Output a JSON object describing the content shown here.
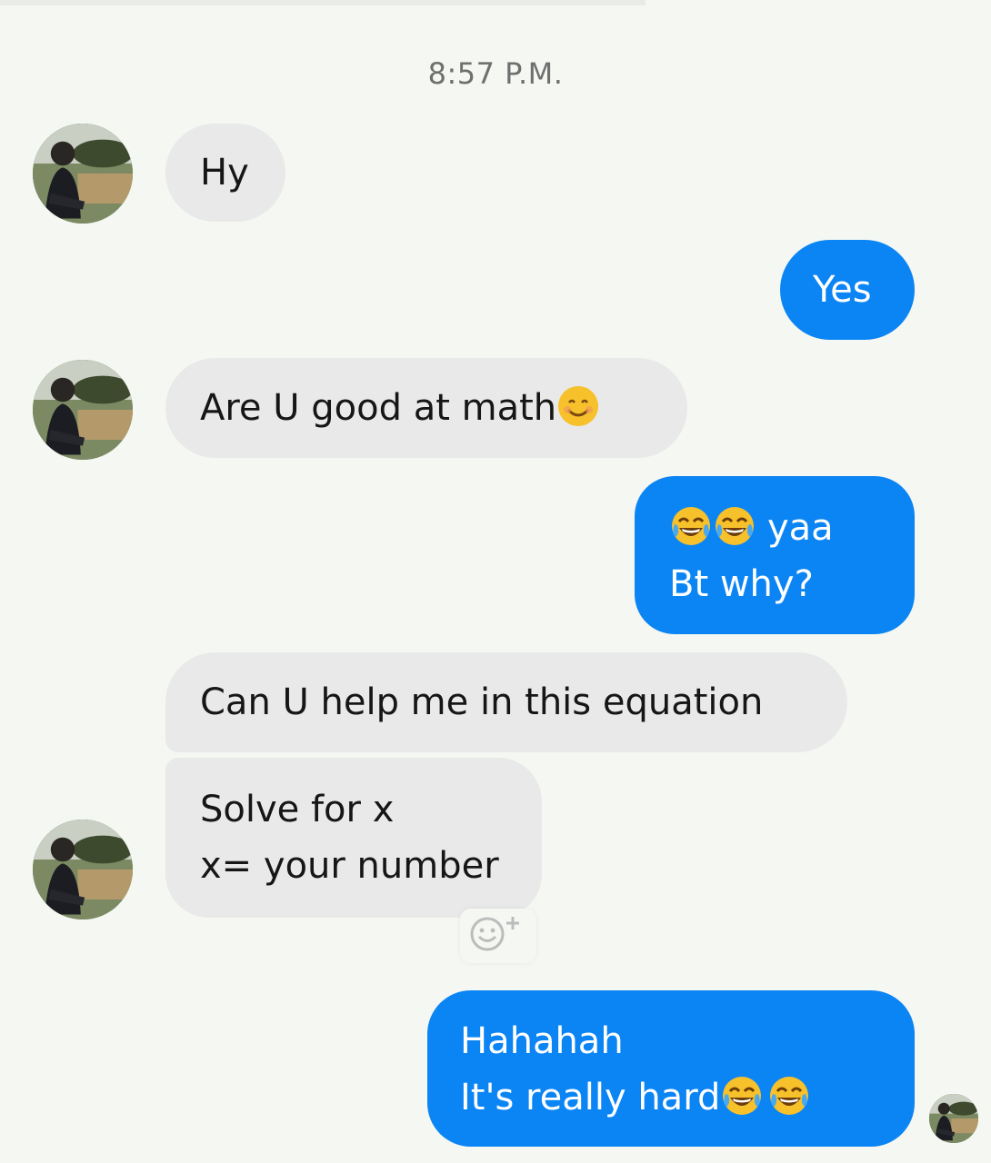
{
  "conversation": {
    "timestamp": "8:57 P.M.",
    "messages": [
      {
        "direction": "incoming",
        "lines": [
          "Hy"
        ]
      },
      {
        "direction": "outgoing",
        "lines": [
          "Yes"
        ]
      },
      {
        "direction": "incoming",
        "lines": [
          "Are U good at math"
        ],
        "emoji": [
          "smiling-face"
        ]
      },
      {
        "direction": "outgoing",
        "lines": [
          "yaa",
          "Bt why?"
        ],
        "emoji": [
          "face-with-tears-of-joy",
          "face-with-tears-of-joy"
        ]
      },
      {
        "direction": "incoming",
        "lines": [
          "Can U help me in this equation"
        ]
      },
      {
        "direction": "incoming",
        "lines": [
          "Solve for x",
          "x= your number"
        ]
      },
      {
        "direction": "outgoing",
        "lines": [
          "Hahahah",
          "It's really hard"
        ],
        "emoji": [
          "face-with-tears-of-joy",
          "face-with-tears-of-joy"
        ]
      }
    ]
  },
  "icons": {
    "add_reaction": "add-reaction-icon",
    "avatar": "contact-avatar"
  },
  "colors": {
    "background": "#f4f7f2",
    "incoming_bubble": "#e9e9ea",
    "outgoing_bubble": "#0b84f4",
    "timestamp": "#6f6f6f"
  }
}
